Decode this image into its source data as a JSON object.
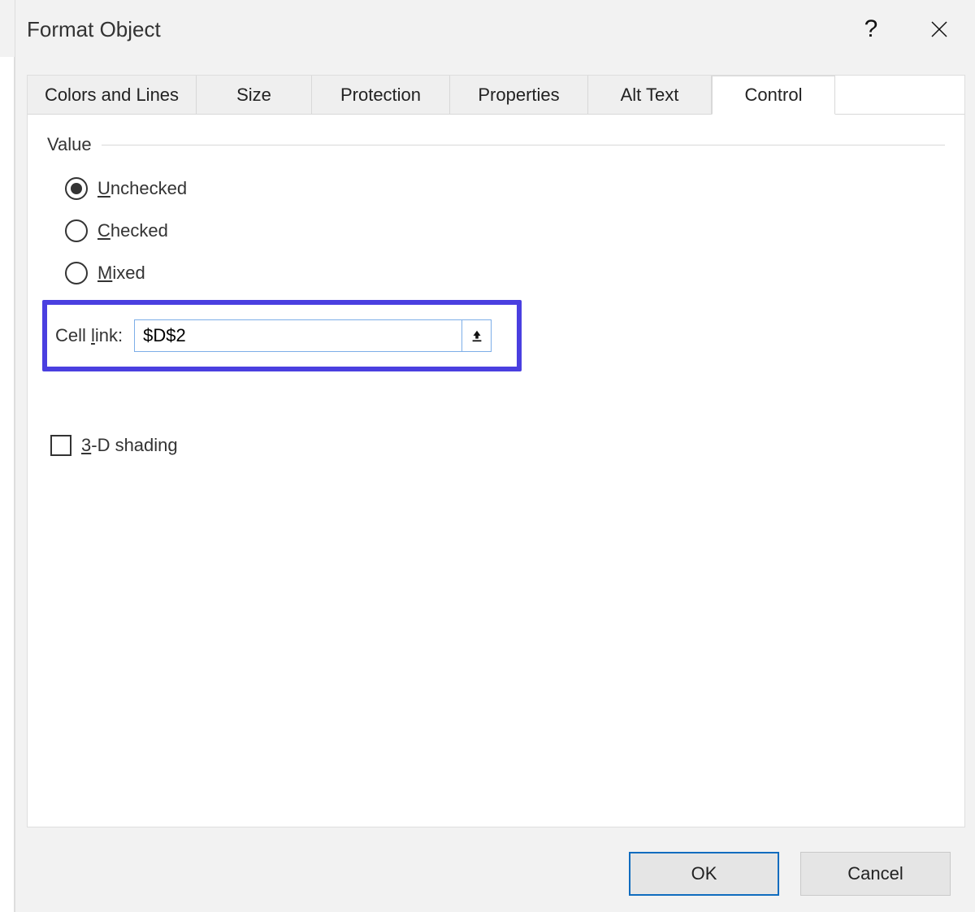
{
  "dialog": {
    "title": "Format Object",
    "help_tooltip": "?",
    "tabs": [
      {
        "label": "Colors and Lines"
      },
      {
        "label": "Size"
      },
      {
        "label": "Protection"
      },
      {
        "label": "Properties"
      },
      {
        "label": "Alt Text"
      },
      {
        "label": "Control"
      }
    ],
    "active_tab": 5,
    "value_group": {
      "legend": "Value",
      "options": {
        "unchecked": {
          "prefix": "U",
          "suffix": "nchecked",
          "selected": true
        },
        "checked": {
          "prefix": "C",
          "suffix": "hecked",
          "selected": false
        },
        "mixed": {
          "prefix": "M",
          "suffix": "ixed",
          "selected": false
        }
      }
    },
    "cell_link": {
      "label_prefix": "Cell ",
      "label_underline": "l",
      "label_suffix": "ink:",
      "value": "$D$2"
    },
    "shading": {
      "prefix": "3",
      "suffix": "-D shading",
      "checked": false
    },
    "buttons": {
      "ok": "OK",
      "cancel": "Cancel"
    }
  }
}
